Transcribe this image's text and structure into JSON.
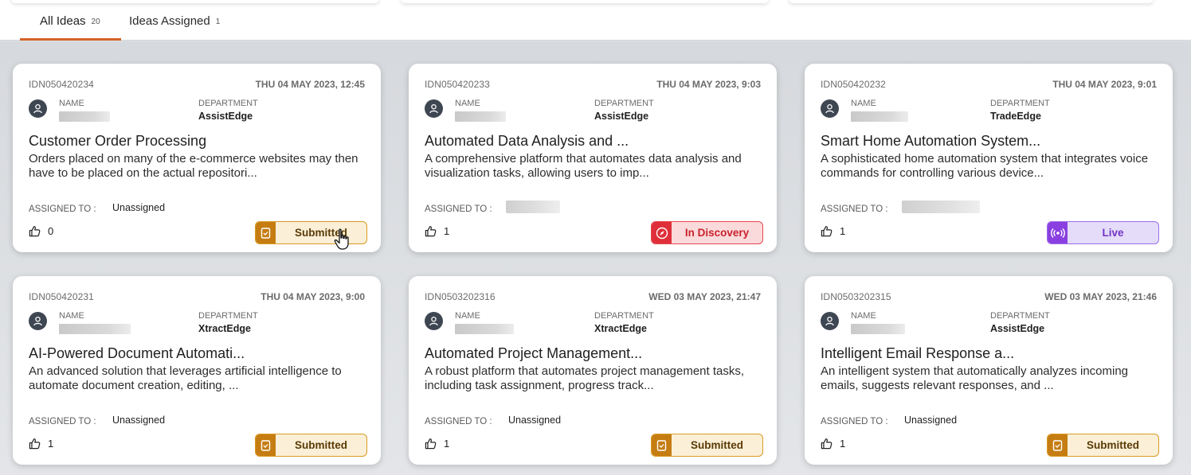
{
  "tabs": [
    {
      "label": "All Ideas",
      "count": "20"
    },
    {
      "label": "Ideas Assigned",
      "count": "1"
    }
  ],
  "labels": {
    "name": "NAME",
    "department": "DEPARTMENT",
    "assigned_to": "ASSIGNED TO :"
  },
  "colors": {
    "active_tab": "#d4622a",
    "submitted": "#c57d12",
    "in_discovery": "#df2f3a",
    "live": "#8a3fe0"
  },
  "cards": [
    {
      "id": "IDN050420234",
      "date": "THU 04 MAY 2023, 12:45",
      "department": "AssistEdge",
      "title": "Customer Order Processing",
      "description": "Orders placed on many of the e-commerce websites may then have to be placed on the actual repositori...",
      "assigned_to": "Unassigned",
      "likes": "0",
      "status": "Submitted",
      "status_icon": "document-icon"
    },
    {
      "id": "IDN050420233",
      "date": "THU 04 MAY 2023, 9:03",
      "department": "AssistEdge",
      "title": "Automated Data Analysis and ...",
      "description": "A comprehensive platform that automates data analysis and visualization tasks, allowing users to imp...",
      "assigned_to": "",
      "likes": "1",
      "status": "In Discovery",
      "status_icon": "compass-icon"
    },
    {
      "id": "IDN050420232",
      "date": "THU 04 MAY 2023, 9:01",
      "department": "TradeEdge",
      "title": "Smart Home Automation System...",
      "description": "A sophisticated home automation system that integrates voice commands for controlling various device...",
      "assigned_to": "",
      "likes": "1",
      "status": "Live",
      "status_icon": "broadcast-icon"
    },
    {
      "id": "IDN050420231",
      "date": "THU 04 MAY 2023, 9:00",
      "department": "XtractEdge",
      "title": "AI-Powered Document Automati...",
      "description": "An advanced solution that leverages artificial intelligence to automate document creation, editing, ...",
      "assigned_to": "Unassigned",
      "likes": "1",
      "status": "Submitted",
      "status_icon": "document-icon"
    },
    {
      "id": "IDN0503202316",
      "date": "WED 03 MAY 2023, 21:47",
      "department": "XtractEdge",
      "title": "Automated Project Management...",
      "description": "A robust platform that automates project management tasks, including task assignment, progress track...",
      "assigned_to": "Unassigned",
      "likes": "1",
      "status": "Submitted",
      "status_icon": "document-icon"
    },
    {
      "id": "IDN0503202315",
      "date": "WED 03 MAY 2023, 21:46",
      "department": "AssistEdge",
      "title": "Intelligent Email Response a...",
      "description": "An intelligent system that automatically analyzes incoming emails, suggests relevant responses, and ...",
      "assigned_to": "Unassigned",
      "likes": "1",
      "status": "Submitted",
      "status_icon": "document-icon"
    }
  ]
}
